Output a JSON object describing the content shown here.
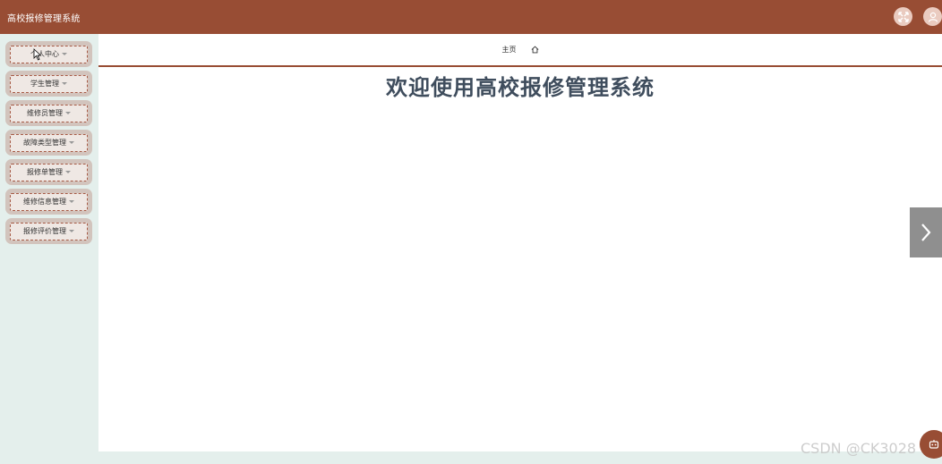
{
  "header": {
    "title": "高校报修管理系统",
    "fullscreen_icon": "fullscreen-icon",
    "user_icon": "user-icon",
    "bg_color": "#984d34"
  },
  "sidebar": {
    "items": [
      {
        "label": "个人中心"
      },
      {
        "label": "学生管理"
      },
      {
        "label": "维修员管理"
      },
      {
        "label": "故障类型管理"
      },
      {
        "label": "报修单管理"
      },
      {
        "label": "维修信息管理"
      },
      {
        "label": "报修评价管理"
      }
    ]
  },
  "breadcrumb": {
    "home_label": "主页",
    "home_icon": "home-icon"
  },
  "main": {
    "welcome": "欢迎使用高校报修管理系统"
  },
  "side_arrow": {
    "icon": "chevron-right-icon"
  },
  "watermark": "CSDN @CK3028"
}
